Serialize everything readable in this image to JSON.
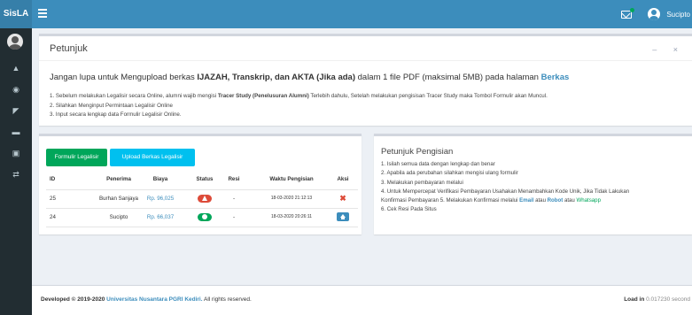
{
  "header": {
    "brand": "SisLA",
    "username": "Sucipto"
  },
  "sidebar": {
    "icons": [
      "home-icon",
      "user-icon",
      "chart-icon",
      "list-icon",
      "lock-icon",
      "shuffle-icon"
    ]
  },
  "petunjuk_box": {
    "title": "Petunjuk",
    "tools": "– ×",
    "notice_part1": "Jangan lupa untuk Mengupload berkas ",
    "notice_bold": "IJAZAH, Transkrip, dan AKTA (Jika ada)",
    "notice_part2": " dalam 1 file PDF (maksimal 5MB) pada halaman ",
    "notice_link": "Berkas",
    "step1_a": "1. Sebelum melakukan Legalisir secara Online, alumni wajib mengisi ",
    "step1_b": "Tracer Study (Penelusuran Alumni)",
    "step1_c": " Terlebih dahulu, Setelah melakukan pengisisan Tracer Study maka Tombol Formulir akan Muncul.",
    "step2": "2. Silahkan Menginput Permintaan Legalisir Online",
    "step3": "3. Input secara lengkap data Formulir Legalisir Online."
  },
  "toolbar": {
    "formulir_label": "Formulir Legalisir",
    "upload_label": "Upload Berkas Legalisir"
  },
  "table": {
    "columns": [
      "ID",
      "Penerima",
      "Biaya",
      "Status",
      "Resi",
      "Waktu Pengisian",
      "Aksi"
    ],
    "rows": [
      {
        "id": "25",
        "penerima": "Burhan Sanjaya",
        "biaya": "Rp. 96,025",
        "resi": "-",
        "waktu": "18-03-2020 21:12:13"
      },
      {
        "id": "24",
        "penerima": "Sucipto",
        "biaya": "Rp. 66,037",
        "resi": "-",
        "waktu": "18-03-2020 20:26:11"
      }
    ]
  },
  "petunjuk_pengisian": {
    "title": "Petunjuk Pengisian",
    "item1": "1. Isilah semua data dengan lengkap dan benar",
    "item2": "2. Apabila ada perubahan silahkan mengisi ulang formulir",
    "item3": "3. Melakukan pembayaran melalui",
    "item4a": "4. Untuk Mempercepat Verifikasi Pembayaran Usahakan Menambahkan Kode Unik, Jika Tidak Lakukan",
    "item4b_a": "Konfirmasi Pembayaran 5. Melakukan Konfirmasi melalui ",
    "item4b_email": "Email",
    "item4b_atau1": " atau ",
    "item4b_robot": "Robot",
    "item4b_atau2": " atau ",
    "item4b_wa": "Whatsapp",
    "item6": "6. Cek Resi Pada Situs"
  },
  "footer": {
    "developed": "Developed © 2019-2020 ",
    "university": "Universitas Nusantara PGRI Kediri.",
    "rights": " All rights reserved.",
    "load_label": "Load in",
    "load_time": " 0.017230 second"
  },
  "colors": {
    "topbar": "#3c8dbc",
    "sidebar": "#222d32",
    "success": "#00a65a",
    "info": "#00c0ef",
    "danger": "#dd4b39"
  }
}
